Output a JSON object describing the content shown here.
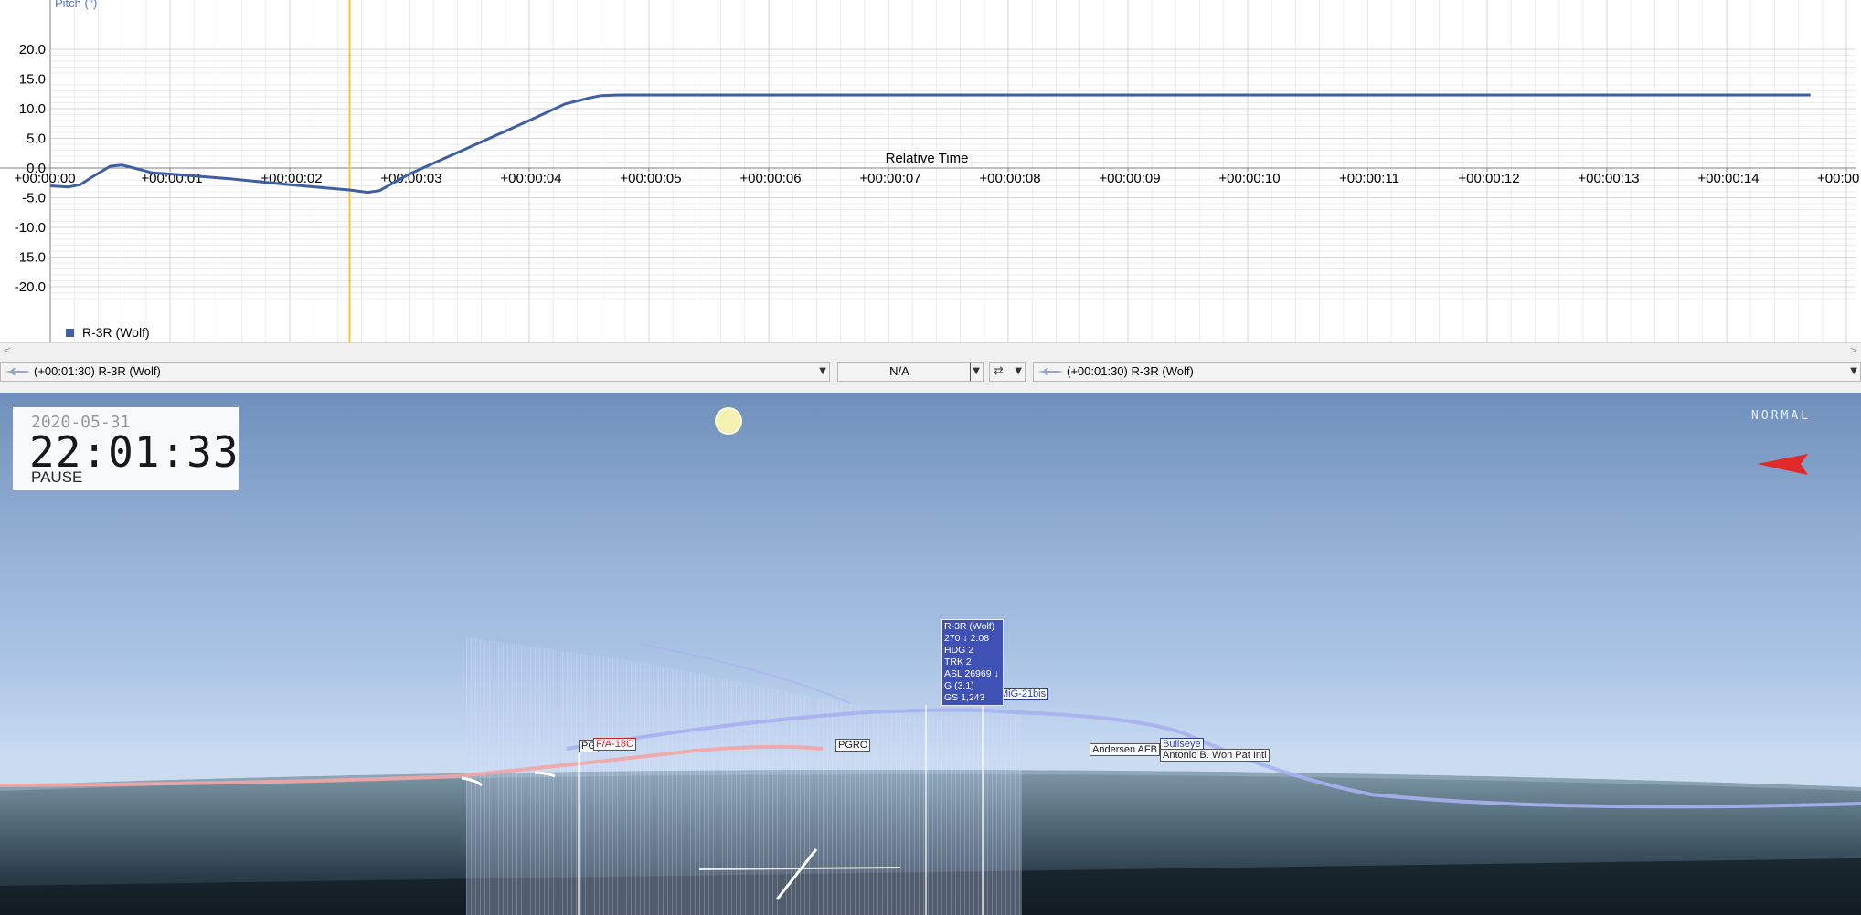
{
  "graph": {
    "y_axis_label": "Pitch (°)",
    "x_axis_label": "Relative Time",
    "legend_label": "R-3R (Wolf)",
    "series_color": "#3f5fa3",
    "cursor_color": "#f5c542"
  },
  "chart_data": {
    "type": "line",
    "ylabel": "Pitch (°)",
    "xlabel": "Relative Time",
    "ylim": [
      -20,
      20
    ],
    "xlim": [
      0,
      15
    ],
    "y_ticks": [
      "20.0",
      "15.0",
      "10.0",
      "5.0",
      "0.0",
      "-5.0",
      "-10.0",
      "-15.0",
      "-20.0"
    ],
    "x_ticks": [
      "+00:00:00",
      "+00:00:01",
      "+00:00:02",
      "+00:00:03",
      "+00:00:04",
      "+00:00:05",
      "+00:00:06",
      "+00:00:07",
      "+00:00:08",
      "+00:00:09",
      "+00:00:10",
      "+00:00:11",
      "+00:00:12",
      "+00:00:13",
      "+00:00:14",
      "+00:00"
    ],
    "grid": true,
    "legend_placement": "bottom-left",
    "cursor_time": 2.5,
    "series": [
      {
        "name": "R-3R (Wolf)",
        "x": [
          0,
          0.15,
          0.25,
          0.35,
          0.5,
          0.6,
          0.7,
          0.85,
          1.0,
          1.5,
          2.0,
          2.5,
          2.65,
          2.75,
          3.0,
          3.5,
          4.0,
          4.3,
          4.5,
          4.6,
          4.75,
          5.0,
          6.0,
          8.0,
          10.0,
          12.0,
          14.0,
          14.7
        ],
        "y": [
          -3.0,
          -3.2,
          -2.8,
          -1.5,
          0.3,
          0.5,
          0.0,
          -0.8,
          -1.0,
          -1.8,
          -2.8,
          -3.7,
          -4.1,
          -3.8,
          -1.0,
          3.5,
          8.0,
          10.8,
          11.8,
          12.2,
          12.3,
          12.3,
          12.3,
          12.3,
          12.3,
          12.3,
          12.3,
          12.3
        ]
      }
    ]
  },
  "selector": {
    "left_object": "(+00:01:30) R-3R (Wolf)",
    "middle_value": "N/A",
    "right_object": "(+00:01:30) R-3R (Wolf)"
  },
  "clock": {
    "date": "2020-05-31",
    "time": "22:01:33",
    "state": "PAUSE"
  },
  "view_mode": "NORMAL",
  "tags": {
    "pg": "PG",
    "fa18": "F/A-18C",
    "pgro": "PGRO",
    "mig21": "MiG-21bis",
    "andersen": "Andersen AFB",
    "bullseye": "Bullseye",
    "antonio": "Antonio B. Won Pat Intl"
  },
  "info_box": {
    "lines": [
      "R-3R (Wolf)",
      "270 ↓ 2.08",
      "HDG 2",
      "TRK 2",
      "ASL 26969 ↓",
      "G (3.1)",
      "GS 1,243"
    ]
  },
  "colors": {
    "sun": "#f6f2b3",
    "enemy_marker": "#e02a2a",
    "track_red": "#f2a5a5",
    "track_blue": "#a9b0f0"
  }
}
